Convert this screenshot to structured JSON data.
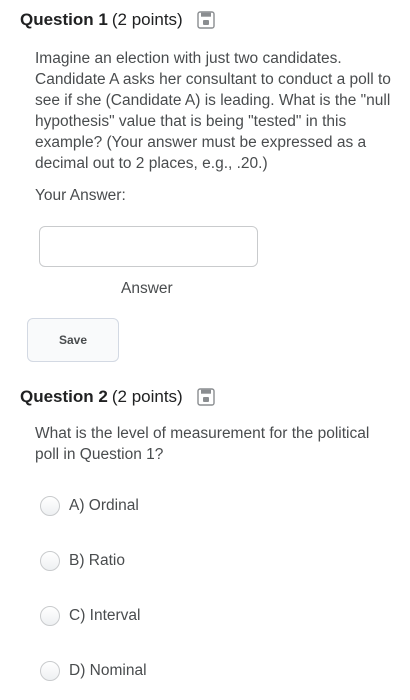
{
  "question1": {
    "title": "Question 1",
    "points": "(2 points)",
    "text": "Imagine an election with just two candidates. Candidate A asks her consultant to conduct a poll to see if she (Candidate A) is leading.  What is the \"null hypothesis\" value that is being \"tested\" in this example?  (Your answer must be expressed as a decimal out to 2 places, e.g., .20.)",
    "answer_label": "Your Answer:",
    "answer_value": "",
    "answer_caption": "Answer",
    "save_label": "Save",
    "icon": "save-icon"
  },
  "question2": {
    "title": "Question 2",
    "points": "(2 points)",
    "text": "What is the level of measurement for the political poll in Question 1?",
    "icon": "save-icon",
    "options": [
      {
        "label": "A) Ordinal"
      },
      {
        "label": "B) Ratio"
      },
      {
        "label": "C) Interval"
      },
      {
        "label": "D) Nominal"
      }
    ]
  }
}
